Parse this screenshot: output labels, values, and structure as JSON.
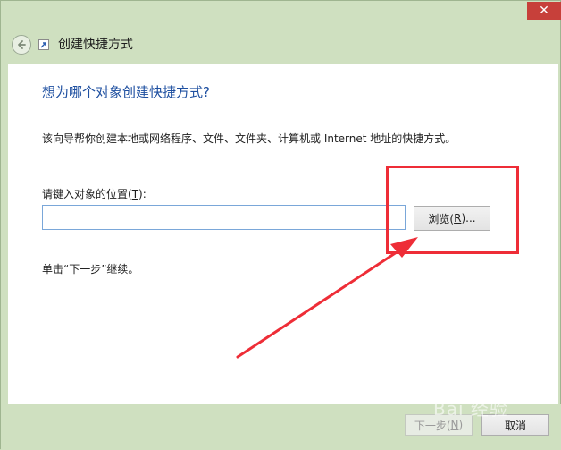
{
  "window": {
    "title": "创建快捷方式",
    "close_label": "✕"
  },
  "wizard": {
    "question": "想为哪个对象创建快捷方式?",
    "description": "该向导帮你创建本地或网络程序、文件、文件夹、计算机或 Internet 地址的快捷方式。",
    "location_label_prefix": "请键入对象的位置(",
    "location_label_key": "T",
    "location_label_suffix": "):",
    "location_value": "",
    "browse_prefix": "浏览(",
    "browse_key": "R",
    "browse_suffix": ")...",
    "next_hint": "单击“下一步”继续。"
  },
  "footer": {
    "next_prefix": "下一步(",
    "next_key": "N",
    "next_suffix": ")",
    "cancel_label": "取消"
  },
  "watermark": {
    "text": "Bai 经验"
  },
  "colors": {
    "annotation": "#ee2d37",
    "accent_heading": "#1e4fa0",
    "window_chrome": "#cfe0c0"
  },
  "icons": {
    "back": "back-arrow-icon",
    "shortcut": "shortcut-icon",
    "close": "close-icon"
  }
}
